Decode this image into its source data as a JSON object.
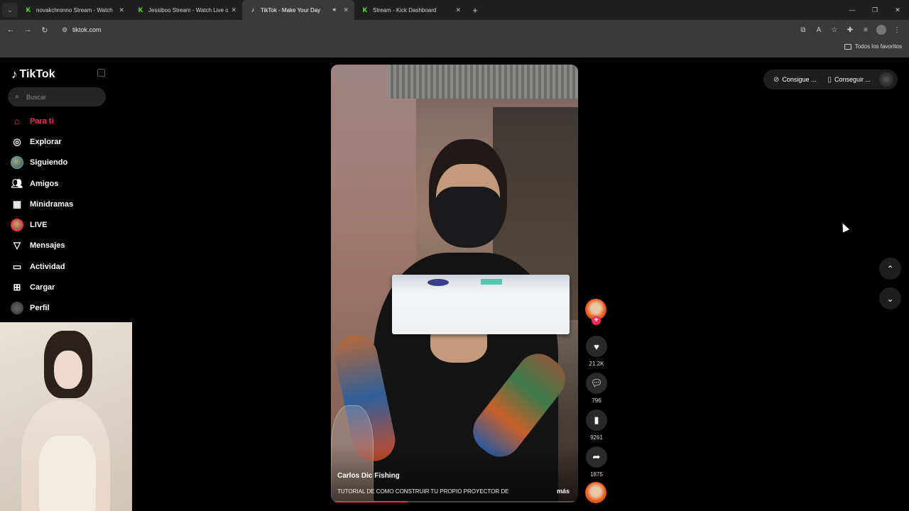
{
  "browser": {
    "tabs": [
      {
        "title": "novakchronno Stream - Watch",
        "favicon": "kick-logo-icon"
      },
      {
        "title": "Jessiboo Stream - Watch Live o",
        "favicon": "kick-logo-icon"
      },
      {
        "title": "TikTok - Make Your Day",
        "favicon": "tiktok-logo-icon",
        "active": true
      },
      {
        "title": "Stream - Kick Dashboard",
        "favicon": "kick-logo-icon"
      }
    ],
    "url": "tiktok.com",
    "bookmarks_all": "Todos los favoritos"
  },
  "tiktok": {
    "logo": "TikTok",
    "search_placeholder": "Buscar",
    "nav": [
      {
        "label": "Para ti",
        "icon": "home-icon",
        "active": true
      },
      {
        "label": "Explorar",
        "icon": "compass-icon"
      },
      {
        "label": "Siguiendo",
        "icon": "following-avatar-icon"
      },
      {
        "label": "Amigos",
        "icon": "friends-icon"
      },
      {
        "label": "Minidramas",
        "icon": "film-icon"
      },
      {
        "label": "LIVE",
        "icon": "live-avatar-icon"
      },
      {
        "label": "Mensajes",
        "icon": "send-icon"
      },
      {
        "label": "Actividad",
        "icon": "activity-icon"
      },
      {
        "label": "Cargar",
        "icon": "upload-icon"
      },
      {
        "label": "Perfil",
        "icon": "profile-avatar-icon"
      }
    ],
    "top_right": {
      "coins_label": "Consigue ...",
      "app_label": "Conseguir ..."
    },
    "video": {
      "author": "Carlos Dic Fishing",
      "caption": "TUTORIAL DE COMO CONSTRUIR TU PROPIO PROYECTOR DE",
      "more": "más",
      "progress": 0.31
    },
    "actions": {
      "likes": "21.2K",
      "comments": "796",
      "saves": "9261",
      "shares": "1875"
    }
  },
  "colors": {
    "accent": "#fe2c55",
    "background": "#000000",
    "kick_green": "#53fc18"
  }
}
